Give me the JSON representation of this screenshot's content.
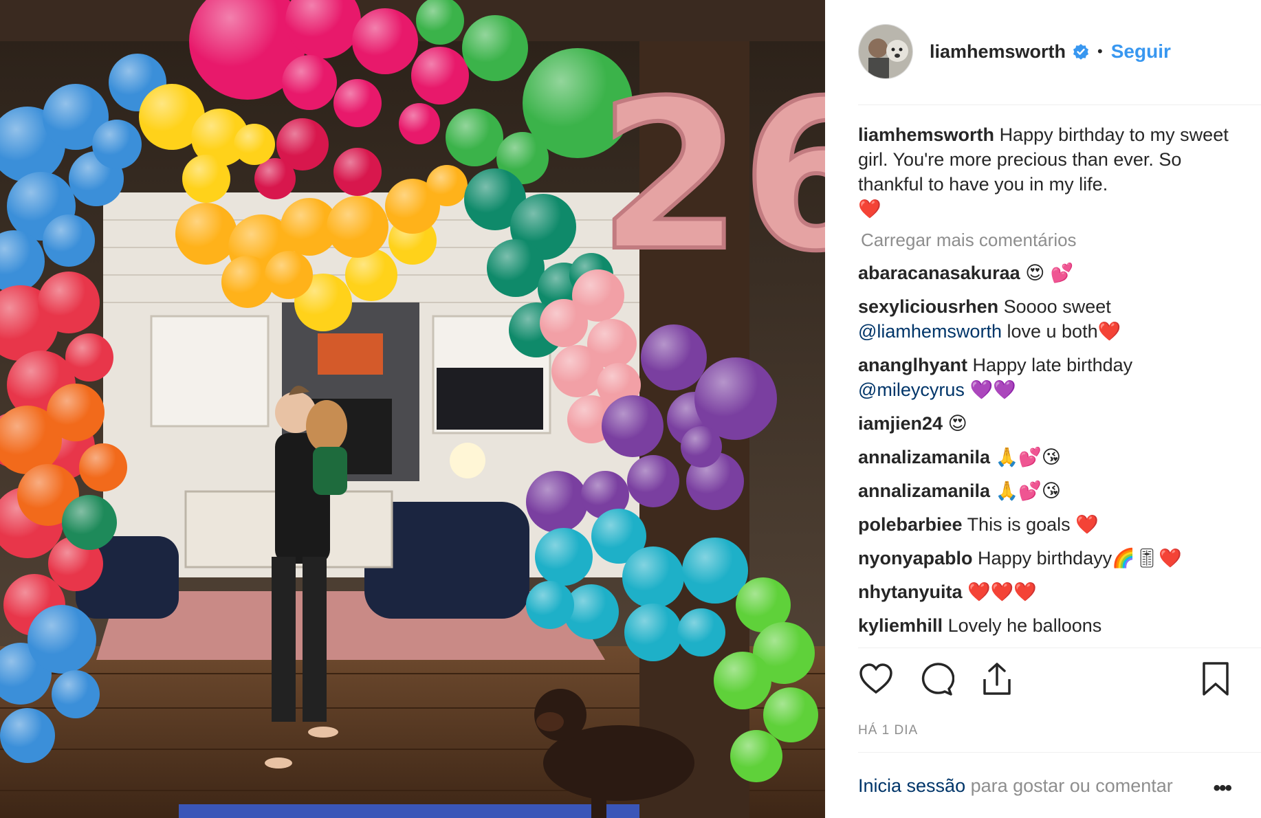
{
  "post": {
    "username": "liamhemsworth",
    "follow_label": "Seguir",
    "dot": "•",
    "caption_text": "Happy birthday to my sweet girl. You're more precious than ever. So thankful to have you in my life.",
    "caption_emoji": "❤️",
    "load_more": "Carregar mais comentários",
    "time": "HÁ 1 DIA"
  },
  "comments": [
    {
      "user": "abaracanasakuraa",
      "emoji": "😍 💕"
    },
    {
      "user": "sexyliciousrhen",
      "text": "Soooo sweet",
      "mention": "@liamhemsworth",
      "text2": "love u both",
      "emoji": "❤️"
    },
    {
      "user": "ananglhyant",
      "text": "Happy late birthday",
      "mention": "@mileycyrus",
      "emoji": "💜💜"
    },
    {
      "user": "iamjien24",
      "emoji": "😍"
    },
    {
      "user": "annalizamanila",
      "emoji": "🙏💕😘"
    },
    {
      "user": "annalizamanila",
      "emoji": "🙏💕😘"
    },
    {
      "user": "polebarbiee",
      "text": "This is goals",
      "emoji": "❤️"
    },
    {
      "user": "nyonyapablo",
      "text": "Happy birthdayy",
      "emoji": "🌈🎚❤️"
    },
    {
      "user": "nhytanyuita",
      "emoji": "❤️❤️❤️"
    },
    {
      "user": "kyliemhill",
      "text": "Lovely he balloons"
    }
  ],
  "footer": {
    "login_link": "Inicia sessão",
    "login_rest": "para gostar ou comentar",
    "more": "•••"
  },
  "photo": {
    "balloon_number": "26"
  },
  "colors": {
    "accent": "#3897f0",
    "text": "#262626",
    "muted": "#8e8e8e",
    "mention": "#003569",
    "heart": "#e8202a"
  }
}
